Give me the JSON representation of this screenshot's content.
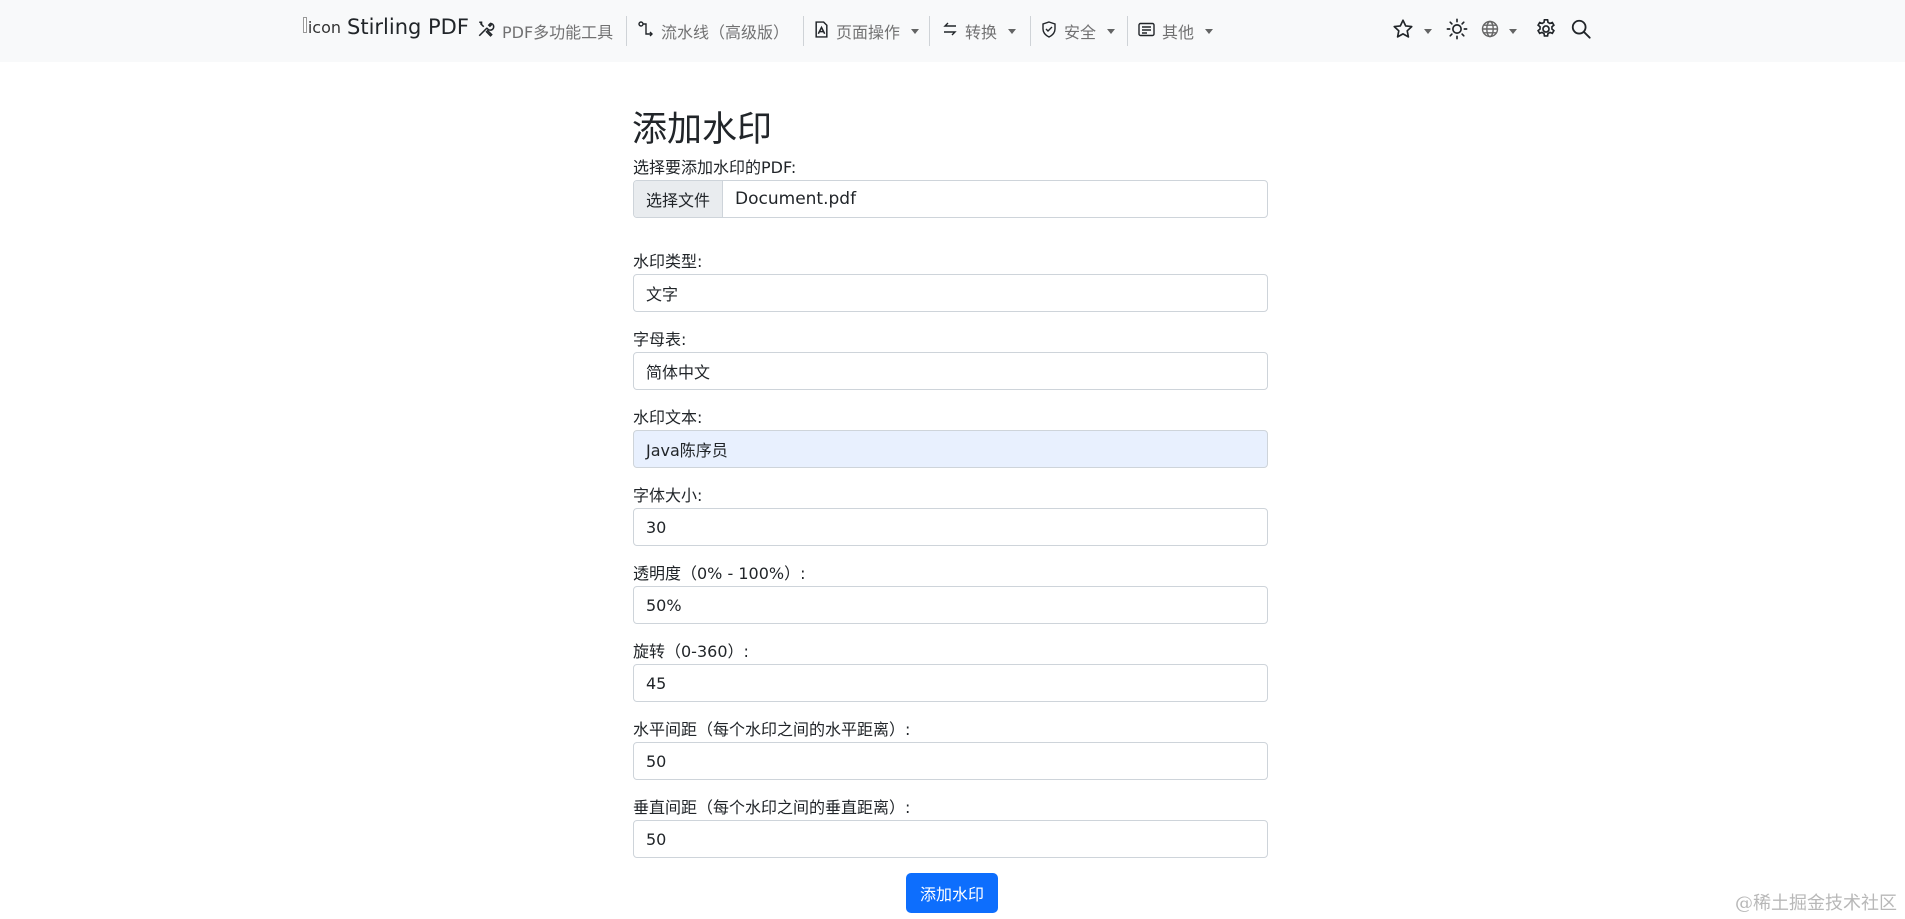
{
  "navbar": {
    "brand": {
      "logo_alt": "icon",
      "title": "Stirling PDF"
    },
    "items": [
      {
        "label": "PDF多功能工具",
        "icon": "tools-icon"
      },
      {
        "label": "流水线（高级版）",
        "icon": "pipeline-icon"
      },
      {
        "label": "页面操作",
        "icon": "file-pdf-icon"
      },
      {
        "label": "转换",
        "icon": "convert-arrows-icon"
      },
      {
        "label": "安全",
        "icon": "shield-icon"
      },
      {
        "label": "其他",
        "icon": "card-text-icon"
      }
    ],
    "right_icons": [
      "star-icon",
      "sun-icon",
      "globe-icon",
      "gear-icon",
      "search-icon"
    ]
  },
  "form": {
    "title": "添加水印",
    "file": {
      "label": "选择要添加水印的PDF:",
      "button": "选择文件",
      "filename": "Document.pdf"
    },
    "watermark_type": {
      "label": "水印类型:",
      "value": "文字"
    },
    "alphabet": {
      "label": "字母表:",
      "value": "简体中文"
    },
    "watermark_text": {
      "label": "水印文本:",
      "value": "Java陈序员"
    },
    "font_size": {
      "label": "字体大小:",
      "value": "30"
    },
    "opacity": {
      "label": "透明度（0% - 100%）:",
      "value": "50%"
    },
    "rotation": {
      "label": "旋转（0-360）:",
      "value": "45"
    },
    "width_spacer": {
      "label": "水平间距（每个水印之间的水平距离）:",
      "value": "50"
    },
    "height_spacer": {
      "label": "垂直间距（每个水印之间的垂直距离）:",
      "value": "50"
    },
    "submit": "添加水印"
  },
  "overlay_watermark": "@稀土掘金技术社区",
  "colors": {
    "primary": "#0d6efd",
    "navbar_bg": "#f8f9fa",
    "selected_field_bg": "#e8f0fe"
  }
}
